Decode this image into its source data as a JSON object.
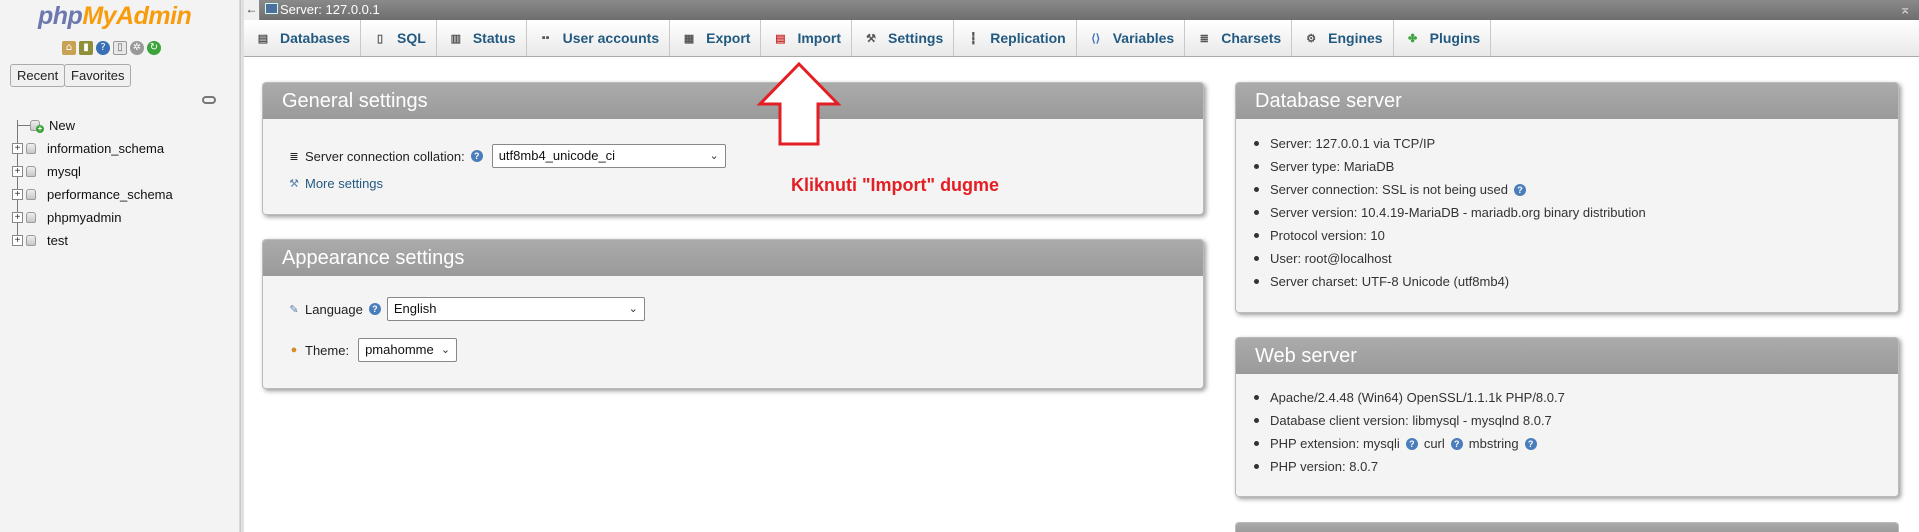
{
  "nav": {
    "logo_php": "php",
    "logo_my": "MyAdmin",
    "tabs": {
      "recent": "Recent",
      "favorites": "Favorites"
    },
    "tree": {
      "new_label": "New",
      "databases": [
        "information_schema",
        "mysql",
        "performance_schema",
        "phpmyadmin",
        "test"
      ]
    }
  },
  "serverbar": {
    "label": "Server: 127.0.0.1",
    "collapse_glyph": "←",
    "right_glyph": "⌅"
  },
  "menubar": {
    "tabs": [
      {
        "label": "Databases",
        "icon": "database-icon"
      },
      {
        "label": "SQL",
        "icon": "sql-icon"
      },
      {
        "label": "Status",
        "icon": "status-icon"
      },
      {
        "label": "User accounts",
        "icon": "users-icon"
      },
      {
        "label": "Export",
        "icon": "export-icon"
      },
      {
        "label": "Import",
        "icon": "import-icon"
      },
      {
        "label": "Settings",
        "icon": "wrench-icon"
      },
      {
        "label": "Replication",
        "icon": "replication-icon"
      },
      {
        "label": "Variables",
        "icon": "variables-icon"
      },
      {
        "label": "Charsets",
        "icon": "charsets-icon"
      },
      {
        "label": "Engines",
        "icon": "engines-icon"
      },
      {
        "label": "Plugins",
        "icon": "plugins-icon"
      }
    ]
  },
  "general_settings": {
    "title": "General settings",
    "collation_label": "Server connection collation:",
    "collation_value": "utf8mb4_unicode_ci",
    "more_settings": "More settings"
  },
  "appearance_settings": {
    "title": "Appearance settings",
    "language_label": "Language",
    "language_value": "English",
    "theme_label": "Theme:",
    "theme_value": "pmahomme"
  },
  "database_server": {
    "title": "Database server",
    "items": [
      "Server: 127.0.0.1 via TCP/IP",
      "Server type: MariaDB",
      "Server connection: SSL is not being used",
      "Server version: 10.4.19-MariaDB - mariadb.org binary distribution",
      "Protocol version: 10",
      "User: root@localhost",
      "Server charset: UTF-8 Unicode (utf8mb4)"
    ]
  },
  "web_server": {
    "title": "Web server",
    "items": [
      "Apache/2.4.48 (Win64) OpenSSL/1.1.1k PHP/8.0.7",
      "Database client version: libmysql - mysqlnd 8.0.7",
      "PHP extension: mysqli",
      "curl",
      "mbstring",
      "PHP version: 8.0.7"
    ]
  },
  "annotation": {
    "text": "Kliknuti \"Import\" dugme",
    "color": "#e31e24"
  },
  "colors": {
    "link": "#235a81",
    "panel_header": "#a5a5a5",
    "logo_php": "#6c78af",
    "logo_my": "#f89c0e"
  }
}
